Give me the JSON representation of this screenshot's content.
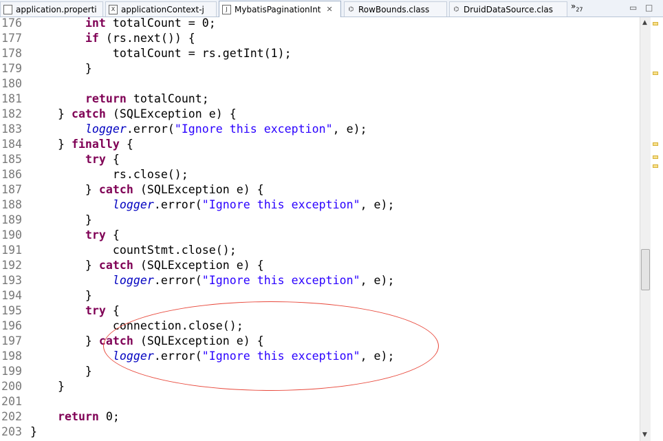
{
  "tabs": [
    {
      "label": "application.properti",
      "icon": "properties-file-icon"
    },
    {
      "label": "applicationContext-j",
      "icon": "xml-file-icon"
    },
    {
      "label": "MybatisPaginationInt",
      "icon": "java-file-icon",
      "active": true
    },
    {
      "label": "RowBounds.class",
      "icon": "class-file-icon"
    },
    {
      "label": "DruidDataSource.clas",
      "icon": "class-file-icon"
    }
  ],
  "overflow": {
    "symbol": "»",
    "count": "27"
  },
  "code_lines": [
    {
      "n": "176",
      "t": [
        [
          "plain",
          "        "
        ],
        [
          "kw",
          "int"
        ],
        [
          "plain",
          " totalCount = 0;"
        ]
      ]
    },
    {
      "n": "177",
      "t": [
        [
          "plain",
          "        "
        ],
        [
          "kw",
          "if"
        ],
        [
          "plain",
          " (rs.next()) {"
        ]
      ]
    },
    {
      "n": "178",
      "t": [
        [
          "plain",
          "            totalCount = rs.getInt(1);"
        ]
      ]
    },
    {
      "n": "179",
      "t": [
        [
          "plain",
          "        }"
        ]
      ]
    },
    {
      "n": "180",
      "t": [
        [
          "plain",
          ""
        ]
      ]
    },
    {
      "n": "181",
      "t": [
        [
          "plain",
          "        "
        ],
        [
          "kw",
          "return"
        ],
        [
          "plain",
          " totalCount;"
        ]
      ]
    },
    {
      "n": "182",
      "t": [
        [
          "plain",
          "    } "
        ],
        [
          "kw",
          "catch"
        ],
        [
          "plain",
          " (SQLException e) {"
        ]
      ]
    },
    {
      "n": "183",
      "t": [
        [
          "plain",
          "        "
        ],
        [
          "it",
          "logger"
        ],
        [
          "plain",
          ".error("
        ],
        [
          "str",
          "\"Ignore this exception\""
        ],
        [
          "plain",
          ", e);"
        ]
      ]
    },
    {
      "n": "184",
      "t": [
        [
          "plain",
          "    } "
        ],
        [
          "kw",
          "finally"
        ],
        [
          "plain",
          " {"
        ]
      ]
    },
    {
      "n": "185",
      "t": [
        [
          "plain",
          "        "
        ],
        [
          "kw",
          "try"
        ],
        [
          "plain",
          " {"
        ]
      ]
    },
    {
      "n": "186",
      "t": [
        [
          "plain",
          "            rs.close();"
        ]
      ]
    },
    {
      "n": "187",
      "t": [
        [
          "plain",
          "        } "
        ],
        [
          "kw",
          "catch"
        ],
        [
          "plain",
          " (SQLException e) {"
        ]
      ]
    },
    {
      "n": "188",
      "t": [
        [
          "plain",
          "            "
        ],
        [
          "it",
          "logger"
        ],
        [
          "plain",
          ".error("
        ],
        [
          "str",
          "\"Ignore this exception\""
        ],
        [
          "plain",
          ", e);"
        ]
      ]
    },
    {
      "n": "189",
      "t": [
        [
          "plain",
          "        }"
        ]
      ]
    },
    {
      "n": "190",
      "t": [
        [
          "plain",
          "        "
        ],
        [
          "kw",
          "try"
        ],
        [
          "plain",
          " {"
        ]
      ]
    },
    {
      "n": "191",
      "t": [
        [
          "plain",
          "            countStmt.close();"
        ]
      ]
    },
    {
      "n": "192",
      "t": [
        [
          "plain",
          "        } "
        ],
        [
          "kw",
          "catch"
        ],
        [
          "plain",
          " (SQLException e) {"
        ]
      ]
    },
    {
      "n": "193",
      "t": [
        [
          "plain",
          "            "
        ],
        [
          "it",
          "logger"
        ],
        [
          "plain",
          ".error("
        ],
        [
          "str",
          "\"Ignore this exception\""
        ],
        [
          "plain",
          ", e);"
        ]
      ]
    },
    {
      "n": "194",
      "t": [
        [
          "plain",
          "        }"
        ]
      ]
    },
    {
      "n": "195",
      "t": [
        [
          "plain",
          "        "
        ],
        [
          "kw",
          "try"
        ],
        [
          "plain",
          " {"
        ]
      ]
    },
    {
      "n": "196",
      "t": [
        [
          "plain",
          "            connection.close();"
        ]
      ]
    },
    {
      "n": "197",
      "t": [
        [
          "plain",
          "        } "
        ],
        [
          "kw",
          "catch"
        ],
        [
          "plain",
          " (SQLException e) {"
        ]
      ]
    },
    {
      "n": "198",
      "t": [
        [
          "plain",
          "            "
        ],
        [
          "it",
          "logger"
        ],
        [
          "plain",
          ".error("
        ],
        [
          "str",
          "\"Ignore this exception\""
        ],
        [
          "plain",
          ", e);"
        ]
      ]
    },
    {
      "n": "199",
      "t": [
        [
          "plain",
          "        }"
        ]
      ]
    },
    {
      "n": "200",
      "t": [
        [
          "plain",
          "    }"
        ]
      ]
    },
    {
      "n": "201",
      "t": [
        [
          "plain",
          ""
        ]
      ]
    },
    {
      "n": "202",
      "t": [
        [
          "plain",
          "    "
        ],
        [
          "kw",
          "return"
        ],
        [
          "plain",
          " 0;"
        ]
      ]
    },
    {
      "n": "203",
      "t": [
        [
          "plain",
          "}"
        ]
      ]
    }
  ],
  "colors": {
    "keyword": "#7f0055",
    "string": "#2a00ff",
    "field": "#0000c0",
    "annotation_circle": "#e8473a"
  }
}
